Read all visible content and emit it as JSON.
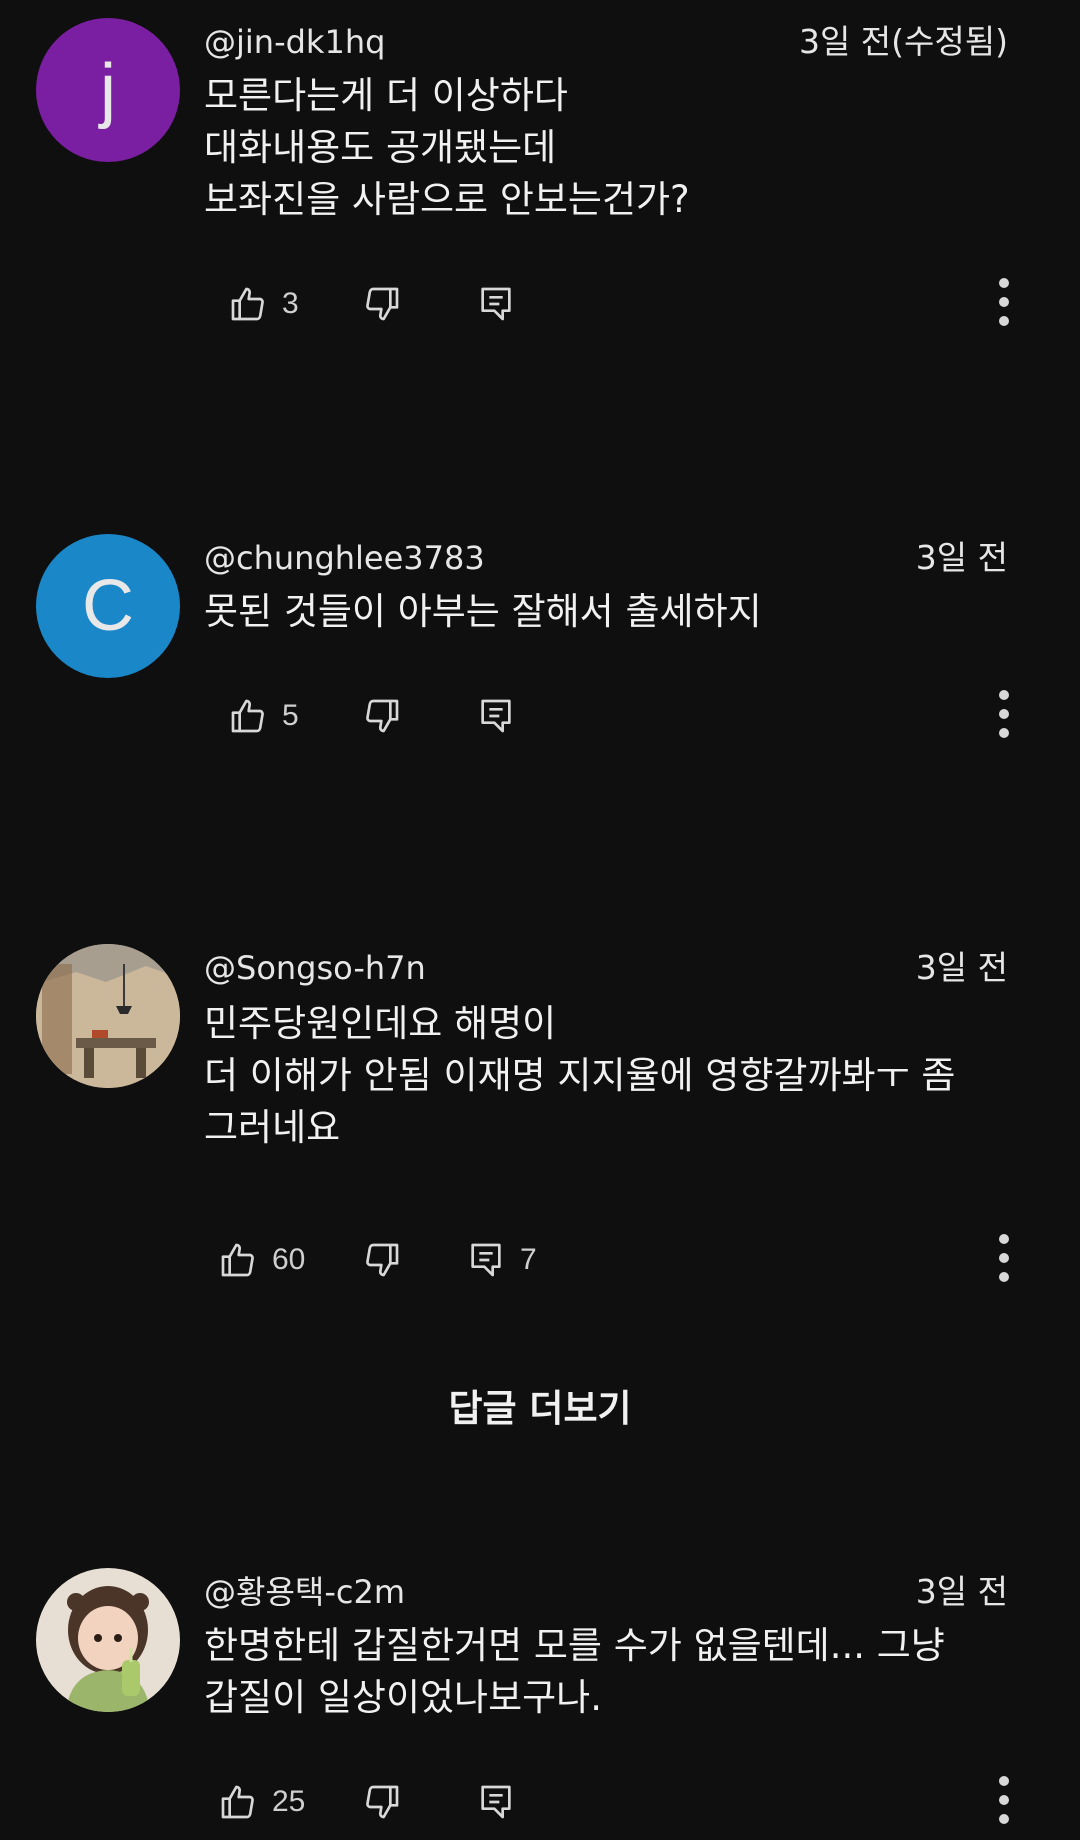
{
  "comments": [
    {
      "handle": "@jin-dk1hq",
      "time": "3일 전(수정됨)",
      "avatar_letter": "j",
      "avatar_color": "#7b1fa2",
      "lines": [
        "모른다는게 더 이상하다",
        "대화내용도 공개됐는데",
        "보좌진을 사람으로 안보는건가?"
      ],
      "likes": "3",
      "replies": ""
    },
    {
      "handle": "@chunghlee3783",
      "time": "3일 전",
      "avatar_letter": "C",
      "avatar_color": "#1a87c9",
      "lines": [
        "못된 것들이 아부는 잘해서 출세하지"
      ],
      "likes": "5",
      "replies": ""
    },
    {
      "handle": "@Songso-h7n",
      "time": "3일 전",
      "avatar_icon": "room-photo-avatar",
      "lines": [
        "민주당원인데요 해명이",
        "더 이해가 안됨 이재명 지지율에 영향갈까봐ㅜ 좀",
        "그러네요"
      ],
      "likes": "60",
      "replies": "7"
    },
    {
      "handle": "@황용택-c2m",
      "time": "3일 전",
      "avatar_icon": "child-photo-avatar",
      "lines": [
        "한명한테 갑질한거면 모를 수가 없을텐데... 그냥",
        "갑질이 일상이었나보구나."
      ],
      "likes": "25",
      "replies": ""
    }
  ],
  "more_replies_label": "답글 더보기",
  "icons": {
    "like": "thumbs-up-icon",
    "dislike": "thumbs-down-icon",
    "reply": "reply-comment-icon",
    "more": "more-vertical-icon"
  },
  "colors": {
    "background": "#0f0f0f",
    "text": "#f1f1f1"
  }
}
